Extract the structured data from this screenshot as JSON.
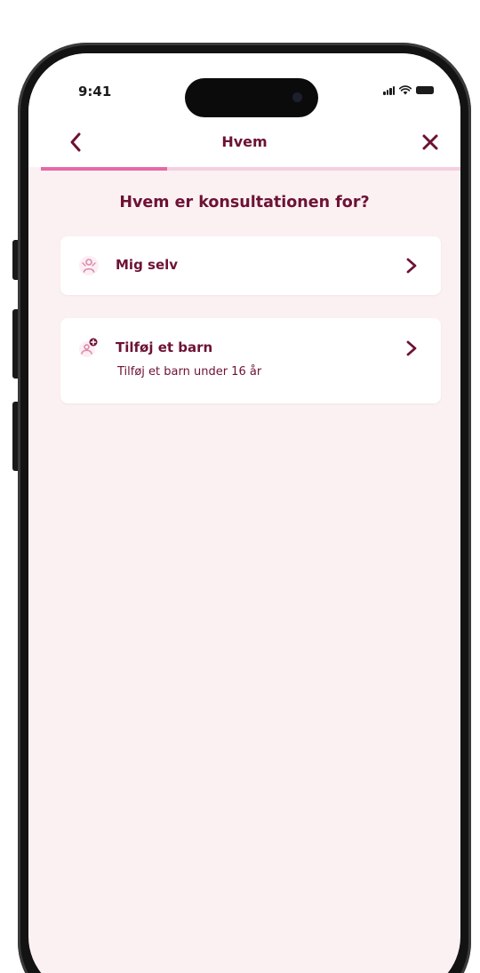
{
  "status_bar": {
    "time": "9:41"
  },
  "nav": {
    "title": "Hvem",
    "back_icon": "chevron-left-icon",
    "close_icon": "close-icon"
  },
  "progress": {
    "fraction": 0.3
  },
  "page": {
    "heading": "Hvem er konsultationen for?"
  },
  "options": [
    {
      "label": "Mig selv",
      "icon": "person-icon"
    },
    {
      "label": "Tilføj et barn",
      "sublabel": "Tilføj et barn under 16 år",
      "icon": "add-child-icon"
    }
  ],
  "colors": {
    "brand": "#6d1235",
    "accent": "#e46aa6",
    "progress_track": "#f4cfe0",
    "background": "#fbf1f2",
    "card": "#ffffff"
  }
}
